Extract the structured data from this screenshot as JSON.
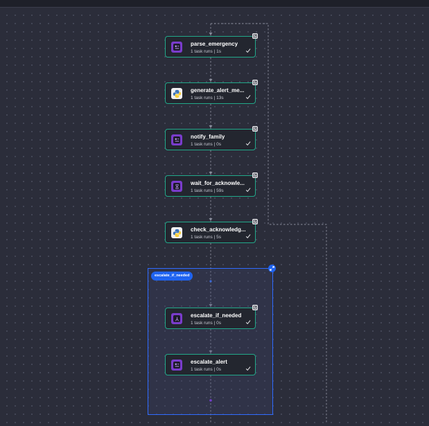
{
  "group": {
    "label": "escalate_if_needed",
    "accent": "#1f63f0"
  },
  "nodes": [
    {
      "name": "parse_emergency",
      "runs": "1 task runs | 1s",
      "icon": "task-icon"
    },
    {
      "name": "generate_alert_me...",
      "runs": "1 task runs | 13s",
      "icon": "python-icon"
    },
    {
      "name": "notify_family",
      "runs": "1 task runs | 0s",
      "icon": "task-icon"
    },
    {
      "name": "wait_for_acknowle...",
      "runs": "1 task runs | 59s",
      "icon": "wait-icon"
    },
    {
      "name": "check_acknowledg...",
      "runs": "1 task runs | 5s",
      "icon": "python-icon"
    },
    {
      "name": "escalate_if_needed",
      "runs": "1 task runs | 0s",
      "icon": "branch-icon"
    },
    {
      "name": "escalate_alert",
      "runs": "1 task runs | 0s",
      "icon": "task-icon"
    }
  ],
  "colors": {
    "canvas": "#2b2d3a",
    "node_border_success": "#22a88a",
    "node_bg": "#23262f",
    "edge": "#8a8d9c"
  }
}
